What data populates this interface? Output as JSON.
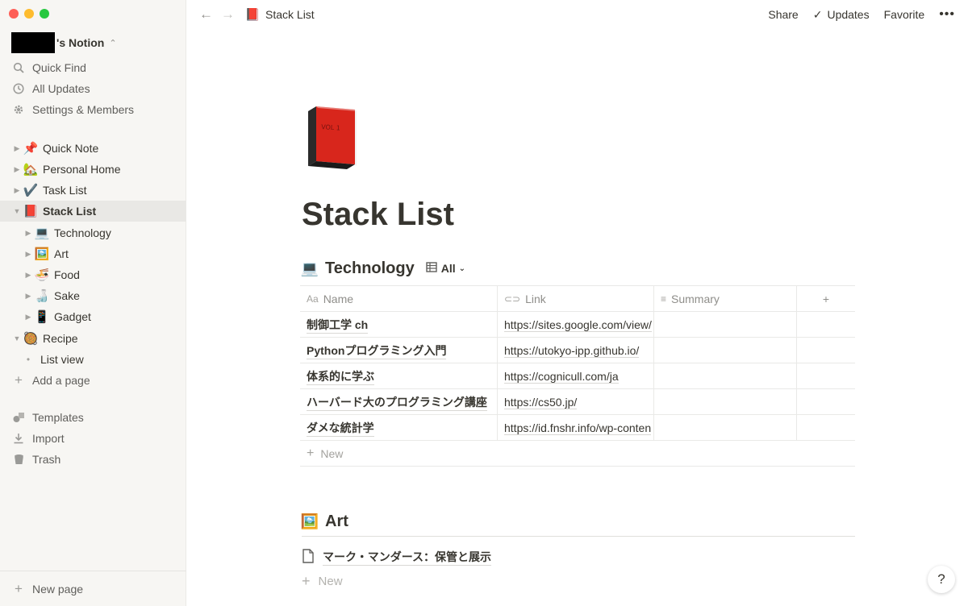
{
  "sidebar": {
    "workspace_name": "'s Notion",
    "nav": [
      {
        "label": "Quick Find",
        "icon": "search-icon"
      },
      {
        "label": "All Updates",
        "icon": "clock-icon"
      },
      {
        "label": "Settings & Members",
        "icon": "gear-icon"
      }
    ],
    "pages": [
      {
        "emoji": "📌",
        "label": "Quick Note"
      },
      {
        "emoji": "🏡",
        "label": "Personal Home"
      },
      {
        "emoji": "✔️",
        "label": "Task List"
      },
      {
        "emoji": "📕",
        "label": "Stack List"
      },
      {
        "emoji": "💻",
        "label": "Technology"
      },
      {
        "emoji": "🖼️",
        "label": "Art"
      },
      {
        "emoji": "🍜",
        "label": "Food"
      },
      {
        "emoji": "🍶",
        "label": "Sake"
      },
      {
        "emoji": "📱",
        "label": "Gadget"
      },
      {
        "emoji": "🥘",
        "label": "Recipe"
      },
      {
        "label": "List view"
      }
    ],
    "add_page": "Add a page",
    "bottom": [
      {
        "label": "Templates",
        "icon": "shapes-icon"
      },
      {
        "label": "Import",
        "icon": "download-icon"
      },
      {
        "label": "Trash",
        "icon": "trash-icon"
      }
    ],
    "new_page": "New page"
  },
  "topbar": {
    "breadcrumb": "Stack List",
    "breadcrumb_emoji": "📕",
    "share": "Share",
    "updates": "Updates",
    "favorite": "Favorite"
  },
  "page": {
    "title": "Stack List",
    "technology": {
      "emoji": "💻",
      "title": "Technology",
      "view": "All",
      "columns": [
        "Name",
        "Link",
        "Summary"
      ],
      "rows": [
        {
          "name": "制御工学 ch",
          "link": "https://sites.google.com/view/"
        },
        {
          "name": "Pythonプログラミング入門",
          "link": "https://utokyo-ipp.github.io/"
        },
        {
          "name": "体系的に学ぶ",
          "link": "https://cognicull.com/ja"
        },
        {
          "name": "ハーバード大のプログラミング講座",
          "link": "https://cs50.jp/"
        },
        {
          "name": "ダメな統計学",
          "link": "https://id.fnshr.info/wp-conten"
        }
      ],
      "new_label": "New"
    },
    "art": {
      "emoji": "🖼️",
      "title": "Art",
      "items": [
        "マーク・マンダース：保管と展示"
      ],
      "new_label": "New"
    }
  },
  "help_label": "?"
}
